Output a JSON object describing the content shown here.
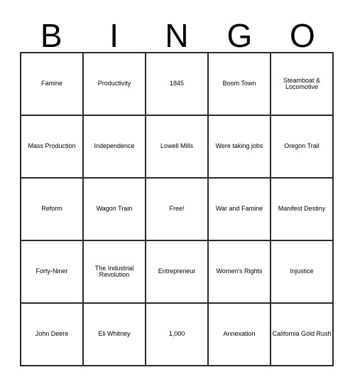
{
  "card": {
    "title_letters": [
      "B",
      "I",
      "N",
      "G",
      "O"
    ],
    "grid": {
      "rows": 5,
      "columns": 5,
      "border_color": "#2b2b2b",
      "background_color": "#ffffff",
      "text_color": "#000000"
    },
    "cells": [
      [
        {
          "text": "Famine"
        },
        {
          "text": "Productivity"
        },
        {
          "text": "1845"
        },
        {
          "text": "Boom Town"
        },
        {
          "text": "Steamboat & Locomotive"
        }
      ],
      [
        {
          "text": "Mass Production"
        },
        {
          "text": "Independence"
        },
        {
          "text": "Lowell Mills"
        },
        {
          "text": "Were taking jobs"
        },
        {
          "text": "Oregon Trail"
        }
      ],
      [
        {
          "text": "Reform"
        },
        {
          "text": "Wagon Train"
        },
        {
          "text": "Free!"
        },
        {
          "text": "War and Famine"
        },
        {
          "text": "Manifest Destiny"
        }
      ],
      [
        {
          "text": "Forty-Niner"
        },
        {
          "text": "The Industrial Revolution"
        },
        {
          "text": "Entrepreneur"
        },
        {
          "text": "Women's Rights"
        },
        {
          "text": "Injustice"
        }
      ],
      [
        {
          "text": "John Deere"
        },
        {
          "text": "Eli Whitney"
        },
        {
          "text": "1,000"
        },
        {
          "text": "Annexation"
        },
        {
          "text": "California Gold Rush"
        }
      ]
    ]
  }
}
